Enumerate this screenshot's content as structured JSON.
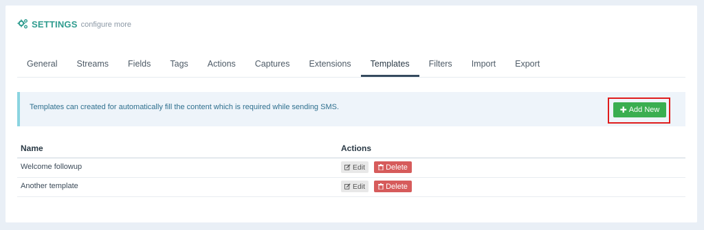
{
  "header": {
    "title": "SETTINGS",
    "subtitle": "configure more",
    "icon": "gears-icon",
    "accent_color": "#2f9c8f"
  },
  "tabs": [
    {
      "label": "General"
    },
    {
      "label": "Streams"
    },
    {
      "label": "Fields"
    },
    {
      "label": "Tags"
    },
    {
      "label": "Actions"
    },
    {
      "label": "Captures"
    },
    {
      "label": "Extensions"
    },
    {
      "label": "Templates",
      "active": true
    },
    {
      "label": "Filters"
    },
    {
      "label": "Import"
    },
    {
      "label": "Export"
    }
  ],
  "info": {
    "text": "Templates can created for automatically fill the content which is required while sending SMS.",
    "add_button_label": "Add New",
    "add_button_color": "#3aae50",
    "highlight_color": "#e01b1b"
  },
  "table": {
    "columns": [
      "Name",
      "Actions"
    ],
    "rows": [
      {
        "name": "Welcome followup",
        "edit": "Edit",
        "delete": "Delete"
      },
      {
        "name": "Another template",
        "edit": "Edit",
        "delete": "Delete"
      }
    ],
    "delete_color": "#d65b5b"
  }
}
